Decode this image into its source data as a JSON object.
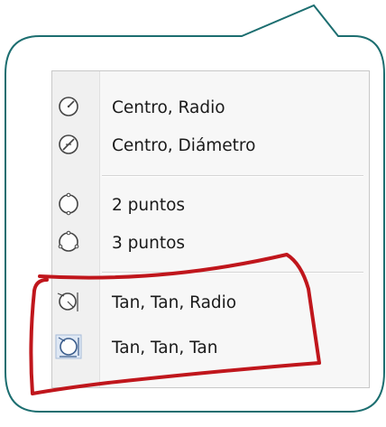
{
  "menu": {
    "items": [
      {
        "label": "Centro, Radio",
        "icon": "circle-center-radius-icon"
      },
      {
        "label": "Centro, Diámetro",
        "icon": "circle-center-diameter-icon"
      },
      {
        "label": "2 puntos",
        "icon": "circle-2-points-icon"
      },
      {
        "label": "3 puntos",
        "icon": "circle-3-points-icon"
      },
      {
        "label": "Tan, Tan, Radio",
        "icon": "circle-tan-tan-radius-icon"
      },
      {
        "label": "Tan, Tan, Tan",
        "icon": "circle-tan-tan-tan-icon"
      }
    ]
  },
  "colors": {
    "callout_border": "#1c6e70",
    "highlight_stroke": "#c0161c"
  }
}
